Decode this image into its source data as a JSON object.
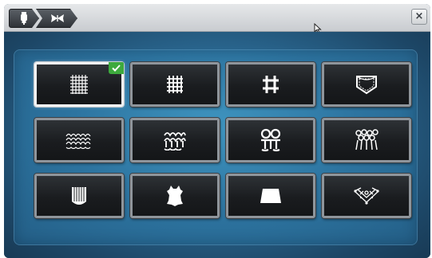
{
  "titlebar": {
    "breadcrumbs": [
      {
        "icon": "stabilizer-icon"
      },
      {
        "icon": "butterfly-icon"
      }
    ],
    "close_label": "×"
  },
  "fabric_grid": {
    "selected_index": 0,
    "items": [
      {
        "icon": "woven-light-fabric-icon"
      },
      {
        "icon": "woven-medium-fabric-icon"
      },
      {
        "icon": "woven-heavy-fabric-icon"
      },
      {
        "icon": "denim-pocket-icon"
      },
      {
        "icon": "knit-light-icon"
      },
      {
        "icon": "knit-medium-icon"
      },
      {
        "icon": "knit-heavy-icon"
      },
      {
        "icon": "terry-towel-icon"
      },
      {
        "icon": "fleece-icon"
      },
      {
        "icon": "leather-hide-icon"
      },
      {
        "icon": "vinyl-sheet-icon"
      },
      {
        "icon": "lace-netting-icon"
      }
    ]
  },
  "colors": {
    "selected_check": "#3daa3d",
    "background": "#2d74a0"
  }
}
